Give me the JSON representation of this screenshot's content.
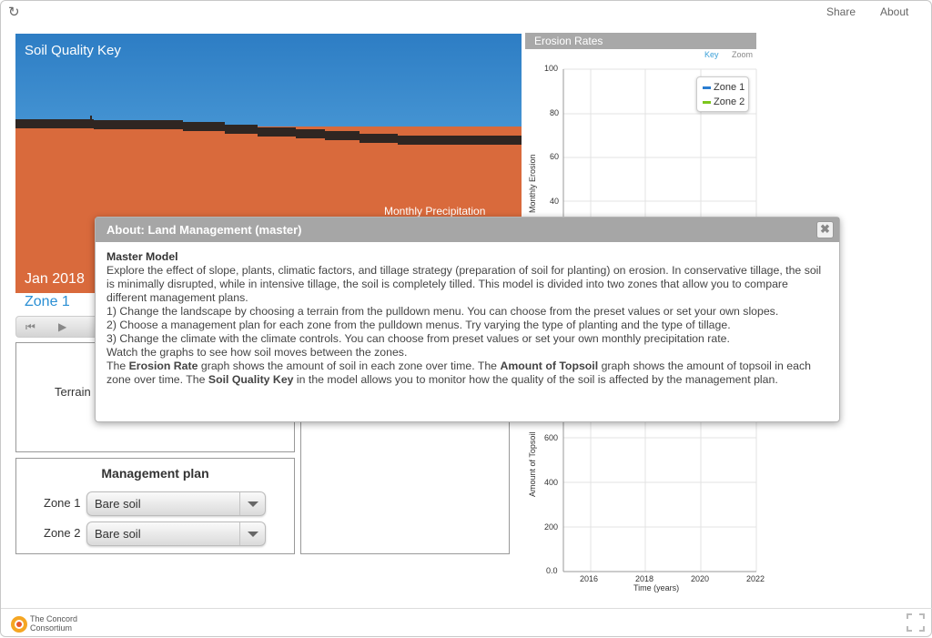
{
  "topbar": {
    "share_label": "Share",
    "about_label": "About"
  },
  "model": {
    "title": "Soil Quality Key",
    "date": "Jan 2018",
    "precip_label": "Monthly Precipitation",
    "sky_color": "#2d7dc4",
    "soil_color": "#d96a3c"
  },
  "zone_label": "Zone 1",
  "terrain": {
    "label": "Terrain"
  },
  "management": {
    "title": "Management plan",
    "zone1_label": "Zone 1",
    "zone1_value": "Bare soil",
    "zone2_label": "Zone 2",
    "zone2_value": "Bare soil"
  },
  "erosion_graph": {
    "title": "Erosion Rates",
    "key_label": "Key",
    "zoom_label": "Zoom",
    "ylabel": "Monthly Erosion",
    "yticks": [
      "100",
      "80",
      "60",
      "40"
    ],
    "legend": [
      {
        "name": "Zone 1",
        "color": "#2a7dd1"
      },
      {
        "name": "Zone 2",
        "color": "#7cc61d"
      }
    ]
  },
  "topsoil_graph": {
    "ylabel": "Amount of Topsoil",
    "yticks": [
      "600",
      "400",
      "200",
      "0.0"
    ],
    "xticks": [
      "2016",
      "2018",
      "2020",
      "2022"
    ],
    "xlabel": "Time (years)"
  },
  "dialog": {
    "title": "About: Land Management (master)",
    "close_glyph": "✖",
    "model_title": "Master Model",
    "p1": "Explore the effect of slope, plants, climatic factors, and tillage strategy (preparation of soil for planting) on erosion. In conservative tillage, the soil is minimally disrupted, while in intensive tillage, the soil is completely tilled. This model is divided into two zones that allow you to compare different management plans.",
    "step1": "1) Change the landscape by choosing a terrain from the pulldown menu. You can choose from the preset values or set your own slopes.",
    "step2": "2) Choose a management plan for each zone from the pulldown menus. Try varying the type of planting and the type of tillage.",
    "step3": "3) Change the climate with the climate controls. You can choose from preset values or set your own monthly precipitation rate.",
    "watch": "Watch the graphs to see how soil moves between the zones.",
    "final_1": "The ",
    "final_b1": "Erosion Rate",
    "final_2": " graph shows the amount of soil in each zone over time. The ",
    "final_b2": "Amount of Topsoil",
    "final_3": " graph shows the amount of topsoil in each zone over time. The ",
    "final_b3": "Soil Quality Key",
    "final_4": " in the model allows you to monitor how the quality of the soil is affected by the management plan."
  },
  "footer": {
    "logo_line1": "The Concord",
    "logo_line2": "Consortium"
  }
}
